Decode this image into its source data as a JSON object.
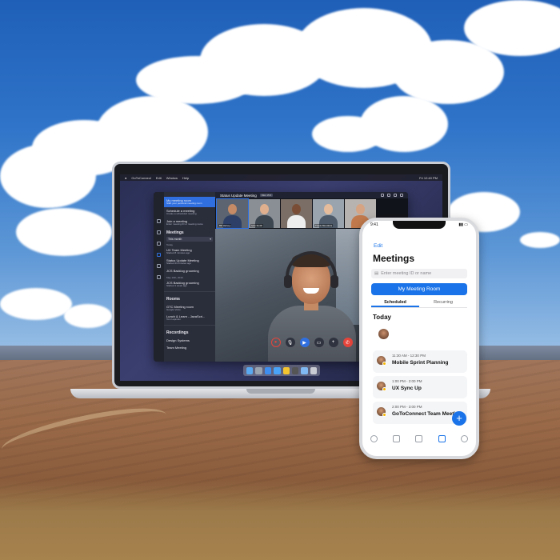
{
  "laptop": {
    "menubar": {
      "app_name": "GoToConnect",
      "menus": [
        "Edit",
        "Window",
        "Help"
      ],
      "clock": "Fri 12:40 PM"
    },
    "sidebar": {
      "items": [
        {
          "label": "My meeting room",
          "sub": "Start your personal meeting room",
          "active": true
        },
        {
          "label": "Schedule a meeting",
          "sub": "Create a scheduled meeting"
        },
        {
          "label": "Join a meeting",
          "sub": "Enter meeting ID or meeting name"
        }
      ],
      "meetings_heading": "Meetings",
      "filter": "This month",
      "today_label": "Today",
      "meetings": [
        {
          "label": "UX Team Meeting",
          "sub": "Started 8 minutes ago"
        },
        {
          "label": "Status Update Meeting",
          "sub": "Started 23 minutes ago"
        },
        {
          "label": "JCS Backlog grooming",
          "sub": ""
        }
      ],
      "date_label": "May 10th, 2019",
      "older_meetings": [
        {
          "label": "JCS Backlog grooming",
          "sub": "Started 1 week ago"
        }
      ],
      "rooms_heading": "Rooms",
      "rooms": [
        {
          "label": "GTC Meeting room",
          "sub": "Google Voice"
        },
        {
          "label": "Lunch & Learn - JavaScri...",
          "sub": "Tom Lapinski"
        }
      ],
      "recordings_heading": "Recordings",
      "recordings": [
        {
          "label": "Design Systems",
          "sub": ""
        },
        {
          "label": "Team Meeting",
          "sub": ""
        }
      ]
    },
    "meeting": {
      "title": "Status Update Meeting",
      "badge": "DEL 15:6",
      "participants": [
        {
          "name": "Bill Harvey"
        },
        {
          "name": "Ivan Smith"
        },
        {
          "name": "Travis Mendoza"
        },
        {
          "name": ""
        },
        {
          "name": ""
        }
      ]
    }
  },
  "phone": {
    "status_time": "9:41",
    "edit_label": "Edit",
    "title": "Meetings",
    "search_placeholder": "Enter meeting ID or name",
    "primary_button": "My Meeting Room",
    "tabs": [
      "Scheduled",
      "Recurring"
    ],
    "active_tab": "Scheduled",
    "day_heading": "Today",
    "meetings": [
      {
        "time": "11:30 AM - 12:30 PM",
        "name": "Mobile Sprint Planning"
      },
      {
        "time": "1:00 PM - 2:00 PM",
        "name": "UX Sync Up"
      },
      {
        "time": "2:00 PM - 3:00 PM",
        "name": "GoToConnect Team Meeting"
      }
    ],
    "fab_symbol": "+",
    "bottom_nav": [
      "person-icon",
      "contacts-icon",
      "phone-icon",
      "video-icon",
      "chat-icon"
    ]
  },
  "colors": {
    "accent": "#1a73e8",
    "end_call": "#e5443b",
    "sky": "#2f74c9",
    "field": "#9a6a49"
  }
}
